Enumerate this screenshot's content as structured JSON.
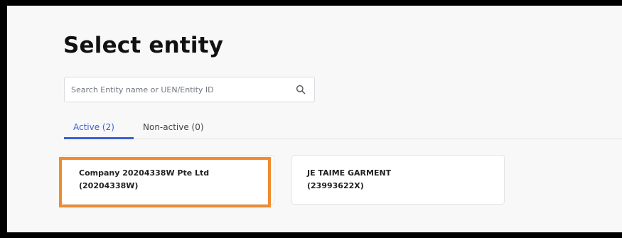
{
  "page": {
    "title": "Select entity"
  },
  "search": {
    "placeholder": "Search Entity name or UEN/Entity ID",
    "value": "",
    "icon": "search-icon"
  },
  "tabs": [
    {
      "label": "Active (2)",
      "active": true
    },
    {
      "label": "Non-active (0)",
      "active": false
    }
  ],
  "entities": [
    {
      "name": "Company 20204338W Pte Ltd",
      "id": "(20204338W)",
      "highlighted": true
    },
    {
      "name": "JE TAIME GARMENT",
      "id": "(23993622X)",
      "highlighted": false
    }
  ],
  "colors": {
    "accent": "#3c5fd6",
    "highlight": "#f28a2e",
    "background": "#f8f8f9"
  }
}
